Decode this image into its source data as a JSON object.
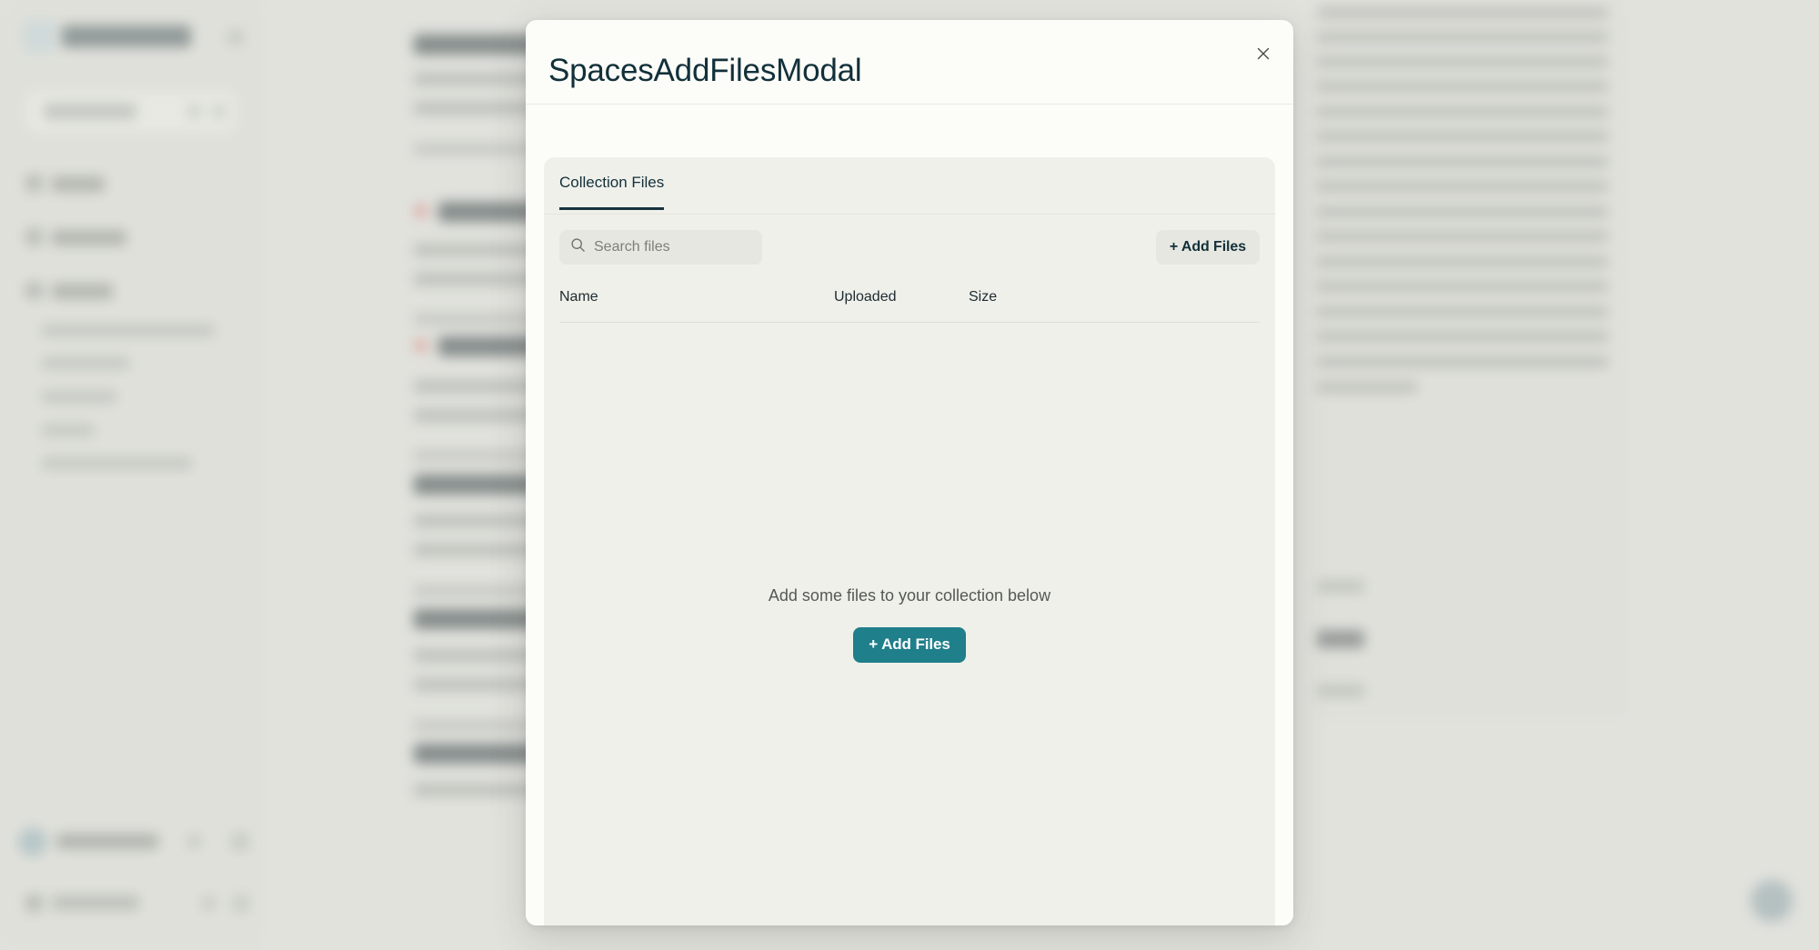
{
  "modal": {
    "title": "SpacesAddFilesModal",
    "close_icon": "close-icon",
    "tabs": [
      {
        "label": "Collection Files",
        "active": true
      }
    ],
    "search": {
      "icon": "search-icon",
      "value": "",
      "placeholder": "Search files"
    },
    "add_files_secondary_label": "+ Add Files",
    "table": {
      "columns": [
        "Name",
        "Uploaded",
        "Size"
      ],
      "rows": []
    },
    "empty_state": {
      "message": "Add some files to your collection below",
      "button_label": "+ Add Files"
    }
  },
  "colors": {
    "accent_teal": "#1F7F8B",
    "title_navy": "#12303A",
    "modal_bg": "#FCFCF8",
    "panel_bg": "#F0F0EA",
    "app_bg": "#DEDFDA",
    "control_bg": "#E6E7E0"
  }
}
